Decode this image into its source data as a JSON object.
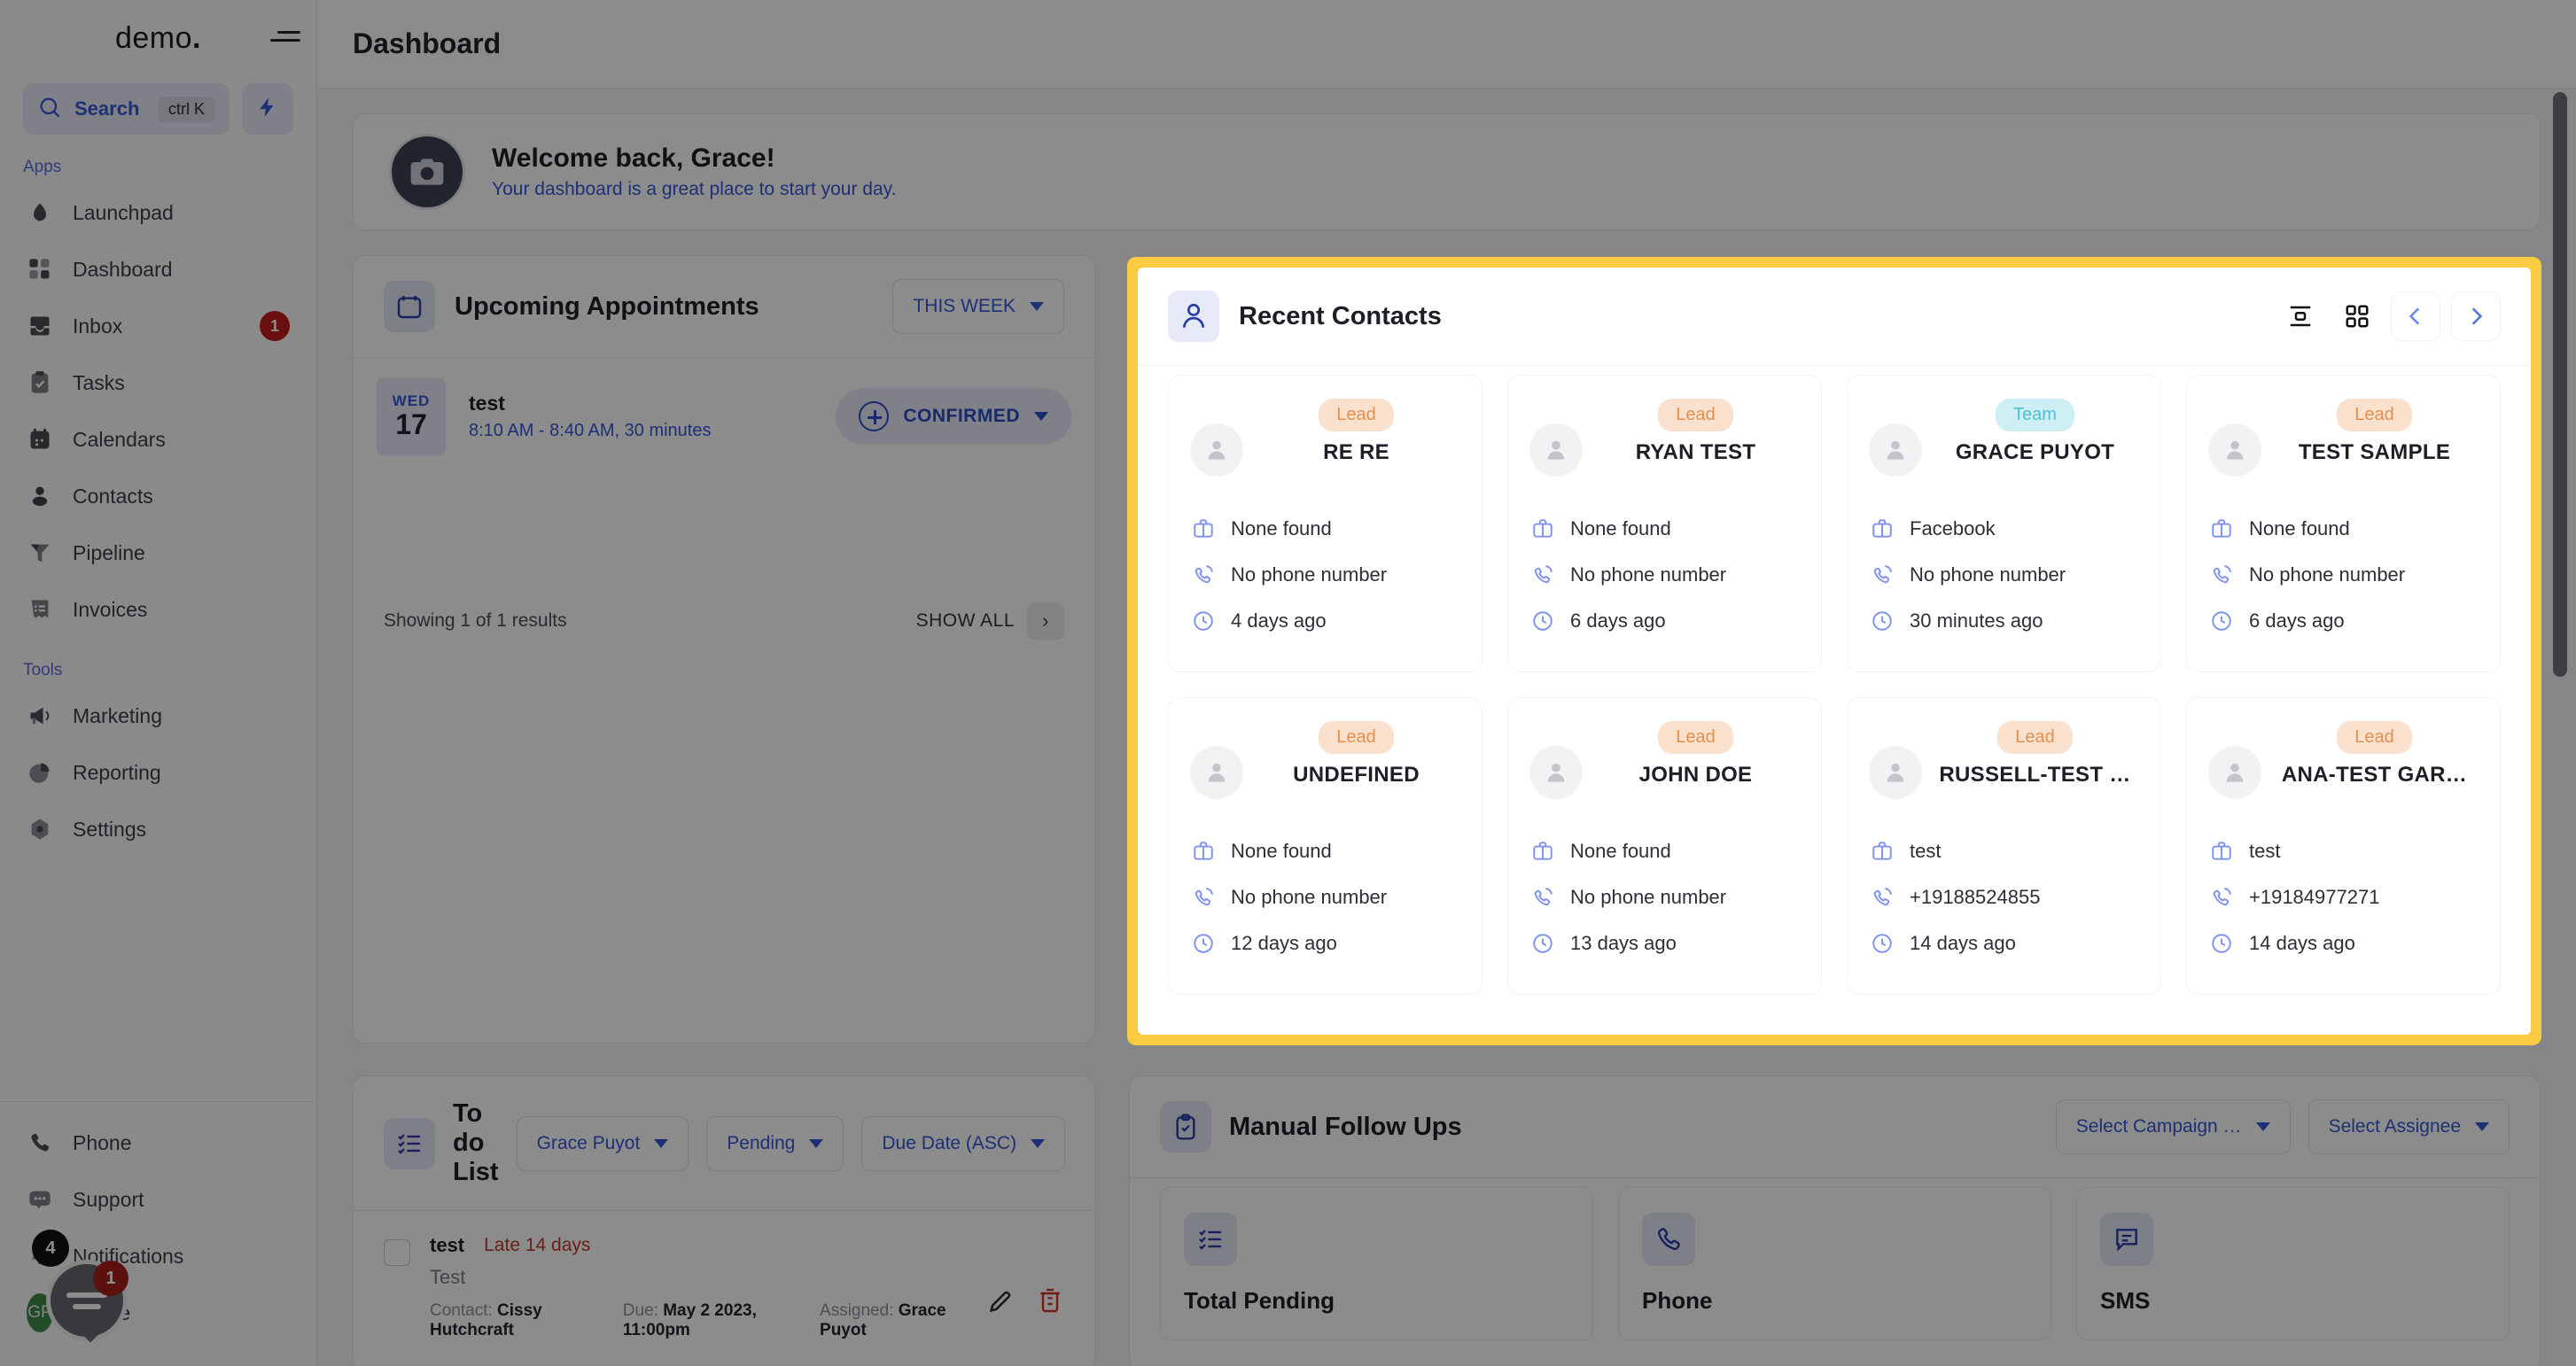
{
  "brand": {
    "name": "demo",
    "dot": "."
  },
  "sidebar": {
    "search": {
      "label": "Search",
      "shortcut": "ctrl K",
      "placeholder": "Search"
    },
    "sections": [
      {
        "label": "Apps"
      },
      {
        "label": "Tools"
      }
    ],
    "apps": [
      {
        "label": "Launchpad",
        "icon": "launchpad-icon"
      },
      {
        "label": "Dashboard",
        "icon": "dashboard-icon"
      },
      {
        "label": "Inbox",
        "icon": "inbox-icon",
        "badge": "1"
      },
      {
        "label": "Tasks",
        "icon": "tasks-icon"
      },
      {
        "label": "Calendars",
        "icon": "calendar-icon"
      },
      {
        "label": "Contacts",
        "icon": "contacts-icon"
      },
      {
        "label": "Pipeline",
        "icon": "pipeline-icon"
      },
      {
        "label": "Invoices",
        "icon": "invoices-icon"
      }
    ],
    "tools": [
      {
        "label": "Marketing",
        "icon": "megaphone-icon"
      },
      {
        "label": "Reporting",
        "icon": "pie-chart-icon"
      },
      {
        "label": "Settings",
        "icon": "gear-icon"
      }
    ],
    "bottom": [
      {
        "label": "Phone",
        "icon": "phone-icon"
      },
      {
        "label": "Support",
        "icon": "support-icon"
      },
      {
        "label": "Notifications",
        "icon": "bell-icon",
        "badge": "4"
      },
      {
        "label": "Profile",
        "icon": "avatar-icon",
        "initials": "GP"
      }
    ],
    "chat_badge": "1"
  },
  "topbar": {
    "title": "Dashboard"
  },
  "welcome": {
    "title": "Welcome back, Grace!",
    "subtitle": "Your dashboard is a great place to start your day.",
    "avatar_icon": "camera-icon"
  },
  "appointments": {
    "title": "Upcoming Appointments",
    "icon": "calendar-icon",
    "range_filter": "THIS WEEK",
    "items": [
      {
        "dow": "WED",
        "day": "17",
        "name": "test",
        "time": "8:10 AM - 8:40 AM, 30 minutes",
        "status": "CONFIRMED"
      }
    ],
    "footer_results": "Showing 1 of 1 results",
    "show_all": "SHOW ALL"
  },
  "recent_contacts": {
    "title": "Recent Contacts",
    "icon": "person-icon",
    "tools": [
      {
        "name": "list-view-icon"
      },
      {
        "name": "grid-view-icon"
      },
      {
        "name": "chevron-left-icon"
      },
      {
        "name": "chevron-right-icon"
      }
    ],
    "highlight_color": "#fbcb42",
    "cards": [
      {
        "badge": "Lead",
        "badge_type": "lead",
        "name": "RE RE",
        "company": "None found",
        "phone": "No phone number",
        "time": "4 days ago"
      },
      {
        "badge": "Lead",
        "badge_type": "lead",
        "name": "RYAN TEST",
        "company": "None found",
        "phone": "No phone number",
        "time": "6 days ago"
      },
      {
        "badge": "Team",
        "badge_type": "team",
        "name": "GRACE PUYOT",
        "company": "Facebook",
        "phone": "No phone number",
        "time": "30 minutes ago"
      },
      {
        "badge": "Lead",
        "badge_type": "lead",
        "name": "TEST SAMPLE",
        "company": "None found",
        "phone": "No phone number",
        "time": "6 days ago"
      },
      {
        "badge": "Lead",
        "badge_type": "lead",
        "name": "UNDEFINED",
        "company": "None found",
        "phone": "No phone number",
        "time": "12 days ago"
      },
      {
        "badge": "Lead",
        "badge_type": "lead",
        "name": "JOHN DOE",
        "company": "None found",
        "phone": "No phone number",
        "time": "13 days ago"
      },
      {
        "badge": "Lead",
        "badge_type": "lead",
        "name": "RUSSELL-TEST …",
        "company": "test",
        "phone": "+19188524855",
        "time": "14 days ago"
      },
      {
        "badge": "Lead",
        "badge_type": "lead",
        "name": "ANA-TEST GAR…",
        "company": "test",
        "phone": "+19184977271",
        "time": "14 days ago"
      }
    ]
  },
  "todo": {
    "title": "To do List",
    "icon": "checklist-icon",
    "filters": [
      {
        "label": "Grace Puyot"
      },
      {
        "label": "Pending"
      },
      {
        "label": "Due Date (ASC)"
      }
    ],
    "items": [
      {
        "title": "test",
        "late": "Late 14 days",
        "desc": "Test",
        "contact_label": "Contact:",
        "contact": "Cissy Hutchcraft",
        "due_label": "Due:",
        "due": "May 2 2023, 11:00pm",
        "assigned_label": "Assigned:",
        "assigned": "Grace Puyot"
      }
    ]
  },
  "manual_follow_ups": {
    "title": "Manual Follow Ups",
    "icon": "clipboard-check-icon",
    "filters": [
      {
        "label": "Select Campaign …"
      },
      {
        "label": "Select Assignee"
      }
    ],
    "cards": [
      {
        "icon": "checklist-icon",
        "label": "Total Pending"
      },
      {
        "icon": "phone-icon",
        "label": "Phone"
      },
      {
        "icon": "sms-icon",
        "label": "SMS"
      }
    ]
  },
  "colors": {
    "accent_blue": "#3558d6",
    "highlight_yellow": "#fbcb42",
    "badge_lead_bg": "#fae1cd",
    "badge_lead_fg": "#e2904f",
    "badge_team_bg": "#cdeef2",
    "badge_team_fg": "#4fc0d4",
    "danger_red": "#c01c1c"
  }
}
